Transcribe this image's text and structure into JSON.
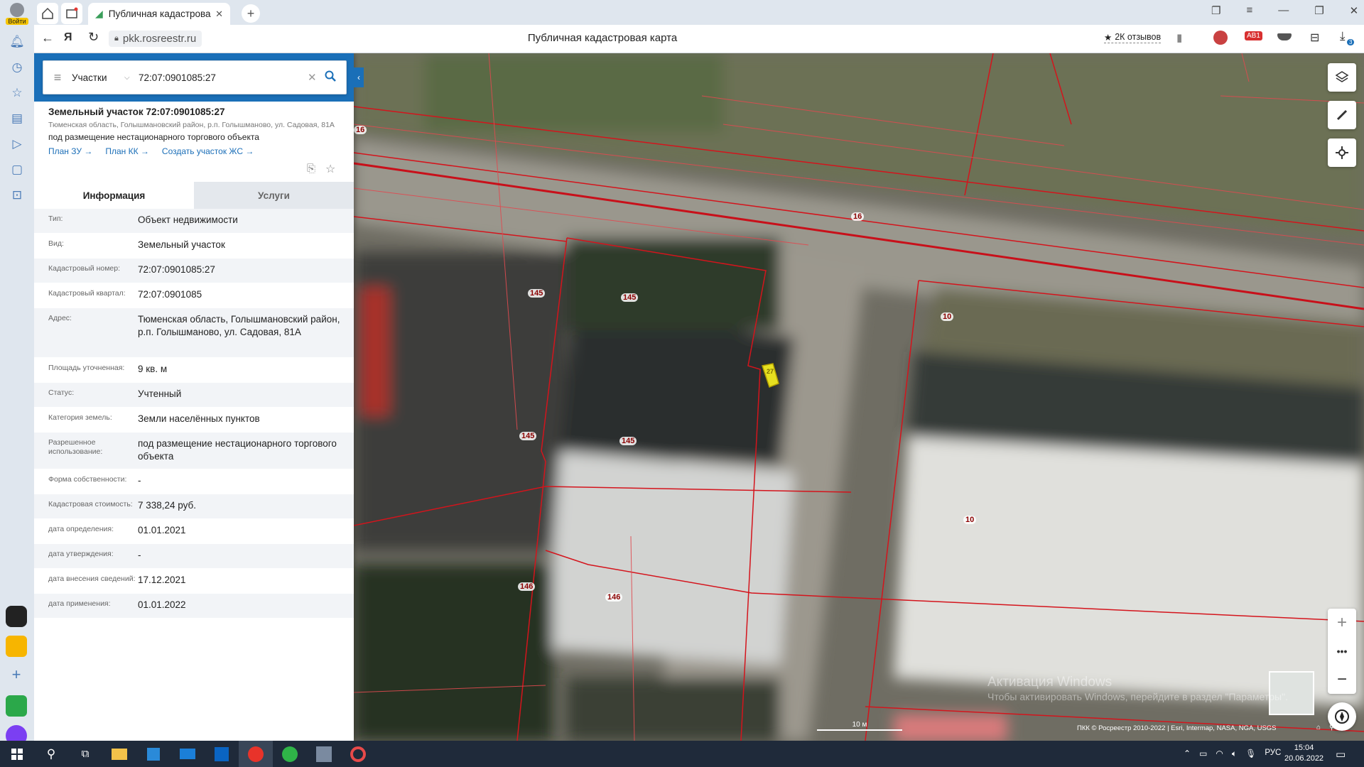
{
  "browser": {
    "login_label": "Войти",
    "tab_title": "Публичная кадастровая карта",
    "url": "pkk.rosreestr.ru",
    "page_title": "Публичная кадастровая карта",
    "reviews": "2К отзывов",
    "adblock_badge": "1",
    "downloads_badge": "3"
  },
  "search": {
    "type": "Участки",
    "query": "72:07:0901085:27"
  },
  "parcel": {
    "title": "Земельный участок 72:07:0901085:27",
    "address_small": "Тюменская область, Голышмановский район, р.п. Голышманово, ул. Садовая, 81А",
    "purpose": "под размещение нестационарного торгового объекта",
    "links": [
      "План ЗУ →",
      "План КК →",
      "Создать участок ЖС →"
    ]
  },
  "tabs": [
    "Информация",
    "Услуги"
  ],
  "info": [
    {
      "k": "Тип:",
      "v": "Объект недвижимости"
    },
    {
      "k": "Вид:",
      "v": "Земельный участок"
    },
    {
      "k": "Кадастровый номер:",
      "v": "72:07:0901085:27"
    },
    {
      "k": "Кадастровый квартал:",
      "v": "72:07:0901085"
    },
    {
      "k": "Адрес:",
      "v": "Тюменская область, Голышмановский район, р.п. Голышманово, ул. Садовая, 81А"
    },
    {
      "k": "Площадь уточненная:",
      "v": "9 кв. м"
    },
    {
      "k": "Статус:",
      "v": "Учтенный"
    },
    {
      "k": "Категория земель:",
      "v": "Земли населённых пунктов"
    },
    {
      "k": "Разрешенное использование:",
      "v": "под размещение нестационарного торгового объекта"
    },
    {
      "k": "Форма собственности:",
      "v": "-"
    },
    {
      "k": "Кадастровая стоимость:",
      "v": "7 338,24 руб."
    },
    {
      "k": "дата определения:",
      "v": "01.01.2021"
    },
    {
      "k": "дата утверждения:",
      "v": "-"
    },
    {
      "k": "дата внесения сведений:",
      "v": "17.12.2021"
    },
    {
      "k": "дата применения:",
      "v": "01.01.2022"
    }
  ],
  "map": {
    "labels": [
      "16",
      "16",
      "145",
      "145",
      "145",
      "145",
      "10",
      "10",
      "146",
      "146",
      "27"
    ],
    "scale": "10 м",
    "attribution": "ПКК © Росреестр 2010-2022 | Esri, Intermap, NASA, NGA, USGS",
    "watermark_1": "Активация Windows",
    "watermark_2": "Чтобы активировать Windows, перейдите в раздел \"Параметры\"."
  },
  "taskbar": {
    "lang": "РУС",
    "time": "15:04",
    "date": "20.06.2022"
  },
  "colors": {
    "accent": "#1c6fb8",
    "boundary": "#d4141c",
    "selected": "#e6e020"
  }
}
